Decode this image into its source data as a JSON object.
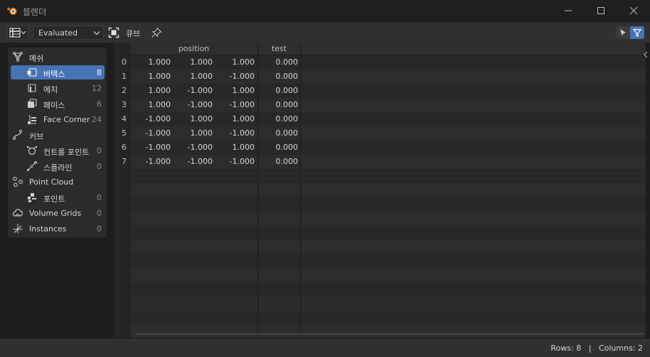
{
  "window": {
    "title": "블렌더",
    "minimize_icon": "minimize-icon",
    "maximize_icon": "maximize-icon",
    "close_icon": "close-icon"
  },
  "header": {
    "editor_type_icon": "spreadsheet-icon",
    "evaluation_mode": "Evaluated",
    "object_icon": "object-icon",
    "object_name": "큐브",
    "pin_icon": "pin-icon",
    "selected_only_icon": "cursor-arrow-icon",
    "filter_icon": "funnel-icon",
    "filter_active_color": "#4772b3"
  },
  "datasets": [
    {
      "label": "메쉬",
      "count": "",
      "icon": "mesh-icon",
      "level": 0,
      "active": false
    },
    {
      "label": "버텍스",
      "count": "8",
      "icon": "vertex-icon",
      "level": 1,
      "active": true
    },
    {
      "label": "에지",
      "count": "12",
      "icon": "edge-icon",
      "level": 1,
      "active": false
    },
    {
      "label": "페이스",
      "count": "6",
      "icon": "face-icon",
      "level": 1,
      "active": false
    },
    {
      "label": "Face Corner",
      "count": "24",
      "icon": "face-corner-icon",
      "level": 1,
      "active": false
    },
    {
      "label": "커브",
      "count": "",
      "icon": "curve-icon",
      "level": 0,
      "active": false
    },
    {
      "label": "컨트롤 포인트",
      "count": "0",
      "icon": "control-point-icon",
      "level": 1,
      "active": false
    },
    {
      "label": "스플라인",
      "count": "0",
      "icon": "spline-icon",
      "level": 1,
      "active": false
    },
    {
      "label": "Point Cloud",
      "count": "",
      "icon": "point-cloud-icon",
      "level": 0,
      "active": false
    },
    {
      "label": "포인트",
      "count": "0",
      "icon": "points-icon",
      "level": 1,
      "active": false
    },
    {
      "label": "Volume Grids",
      "count": "0",
      "icon": "volume-icon",
      "level": 0,
      "active": false
    },
    {
      "label": "Instances",
      "count": "0",
      "icon": "instances-icon",
      "level": 0,
      "active": false
    }
  ],
  "spreadsheet": {
    "columns": [
      "position",
      "test"
    ],
    "rows": [
      {
        "index": "0",
        "position": [
          "1.000",
          "1.000",
          "1.000"
        ],
        "test": "0.000"
      },
      {
        "index": "1",
        "position": [
          "1.000",
          "1.000",
          "-1.000"
        ],
        "test": "0.000"
      },
      {
        "index": "2",
        "position": [
          "1.000",
          "-1.000",
          "1.000"
        ],
        "test": "0.000"
      },
      {
        "index": "3",
        "position": [
          "1.000",
          "-1.000",
          "-1.000"
        ],
        "test": "0.000"
      },
      {
        "index": "4",
        "position": [
          "-1.000",
          "1.000",
          "1.000"
        ],
        "test": "0.000"
      },
      {
        "index": "5",
        "position": [
          "-1.000",
          "1.000",
          "-1.000"
        ],
        "test": "0.000"
      },
      {
        "index": "6",
        "position": [
          "-1.000",
          "-1.000",
          "1.000"
        ],
        "test": "0.000"
      },
      {
        "index": "7",
        "position": [
          "-1.000",
          "-1.000",
          "-1.000"
        ],
        "test": "0.000"
      }
    ]
  },
  "status": {
    "rows": "Rows: 8",
    "separator": "|",
    "columns": "Columns: 2"
  }
}
